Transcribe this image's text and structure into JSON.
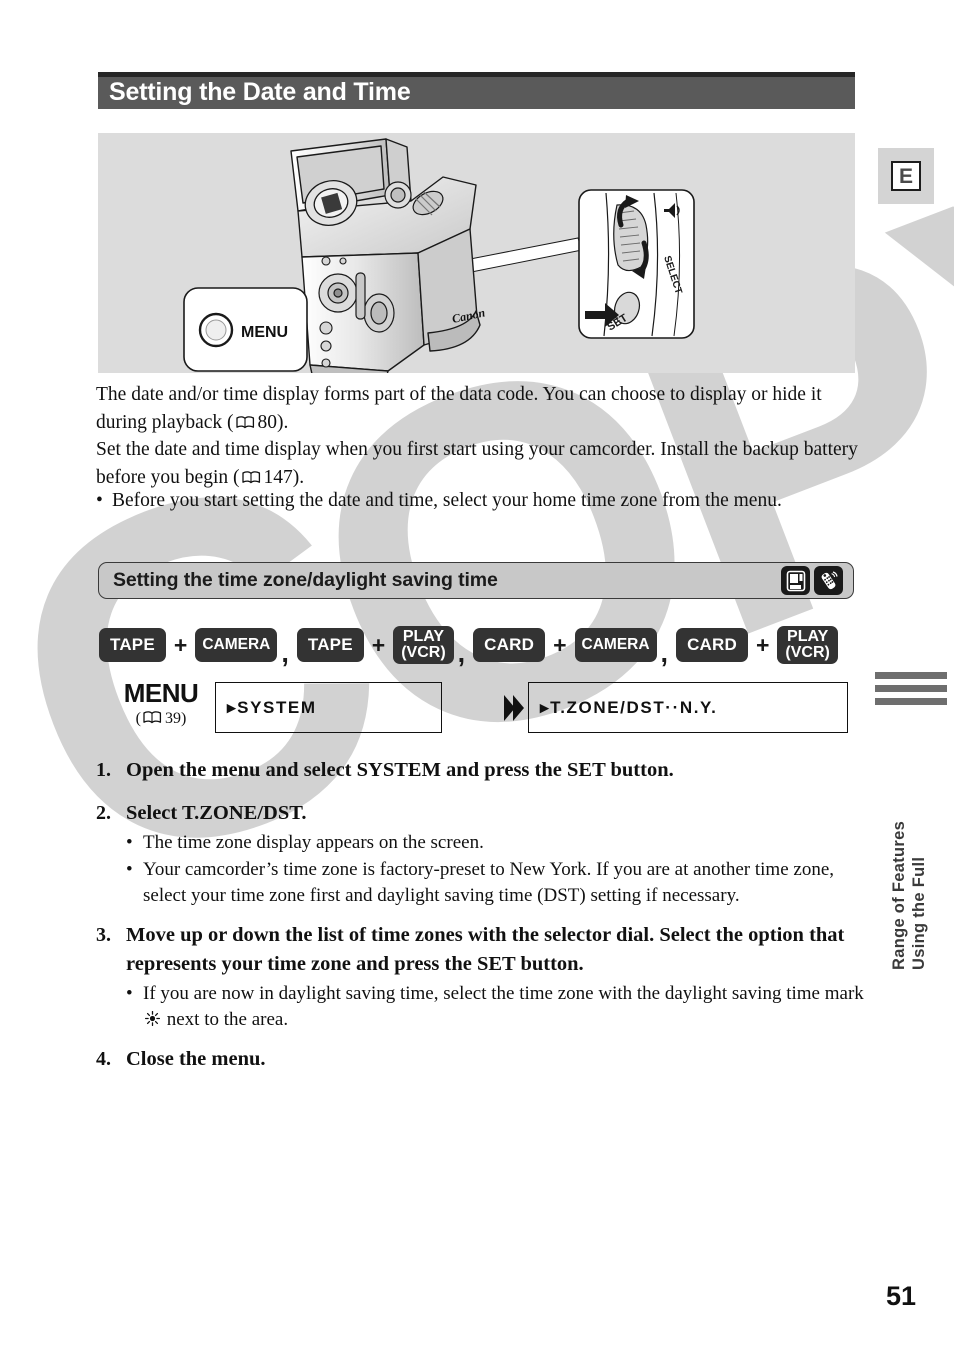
{
  "page": {
    "title": "Setting the Date and Time",
    "number": "51",
    "language_tab": "E",
    "watermark": "COPY"
  },
  "illustration": {
    "menu_callout_label": "MENU",
    "dial_labels": [
      "SELECT",
      "SET"
    ],
    "brand": "Canon"
  },
  "intro": {
    "paragraph_1_a": "The date and/or time display forms part of the data code. You can choose to display or hide it during playback (",
    "paragraph_1_ref": "80",
    "paragraph_1_b": ").",
    "paragraph_2_a": "Set the date and time display when you first start using your camcorder. Install the backup battery before you begin (",
    "paragraph_2_ref": "147",
    "paragraph_2_b": ").",
    "bullet_1": "Before you start setting the date and time, select your home time zone from the menu."
  },
  "section": {
    "header": "Setting the time zone/daylight saving time",
    "icons": [
      "card-camcorder-icon",
      "remote-control-icon"
    ]
  },
  "modes": {
    "groups": [
      {
        "left": "TAPE",
        "right": "CAMERA"
      },
      {
        "left": "TAPE",
        "right_line1": "PLAY",
        "right_line2": "(VCR)"
      },
      {
        "left": "CARD",
        "right": "CAMERA"
      },
      {
        "left": "CARD",
        "right_line1": "PLAY",
        "right_line2": "(VCR)"
      }
    ],
    "plus": "+",
    "comma": ","
  },
  "menu": {
    "label": "MENU",
    "ref_open": "(",
    "ref_page": "39",
    "ref_close": ")",
    "box1": "▸SYSTEM",
    "chevron": "❯",
    "box2": "▸T.ZONE/DST··N.Y."
  },
  "steps": [
    {
      "num": "1.",
      "head": "Open the menu and select SYSTEM and press the SET button.",
      "bullets": []
    },
    {
      "num": "2.",
      "head": "Select T.ZONE/DST.",
      "bullets": [
        "The time zone display appears on the screen.",
        "Your camcorder’s time zone is factory-preset to New York. If you are at another time zone, select your time zone first and daylight saving time (DST) setting if necessary."
      ]
    },
    {
      "num": "3.",
      "head": "Move up or down the list of time zones with the selector dial. Select the option that represents your time zone and press the SET button.",
      "bullets": [
        "If you are now in daylight saving time, select the time zone with the daylight saving time mark ※ next to the area."
      ],
      "bullet_before_mark": "If you are now in daylight saving time, select the time zone with the daylight saving time mark",
      "bullet_after_mark": "next to the area."
    },
    {
      "num": "4.",
      "head": "Close the menu.",
      "bullets": []
    }
  ],
  "rail": {
    "vertical_title_line1": "Using the Full",
    "vertical_title_line2": "Range of Features"
  },
  "colors": {
    "title_bar": "#5a5a5a",
    "title_bar_top": "#262626",
    "section_bar": "#c8c8c8",
    "badge": "#333333",
    "illustration_bg": "#dcdcdc",
    "watermark": "#d2d2d2"
  }
}
